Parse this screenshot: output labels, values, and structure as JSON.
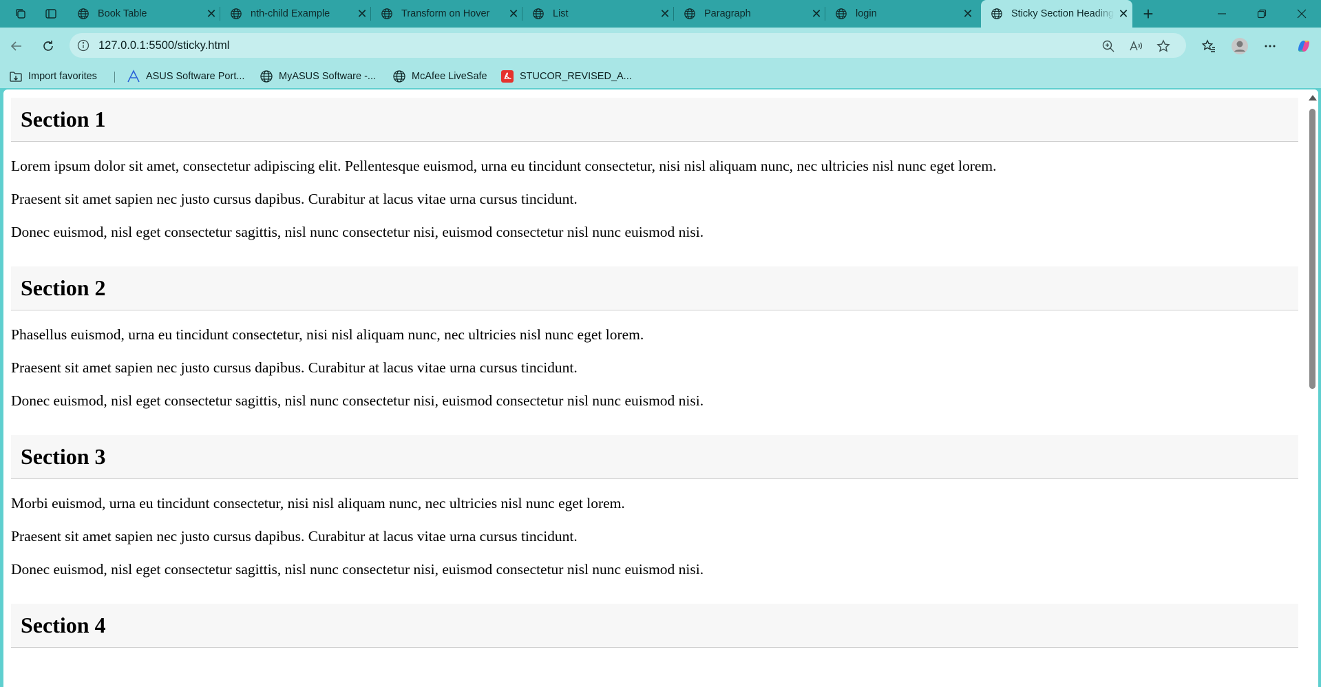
{
  "browser": {
    "tabs": [
      {
        "label": "Book Table",
        "active": false
      },
      {
        "label": "nth-child Example",
        "active": false
      },
      {
        "label": "Transform on Hover",
        "active": false
      },
      {
        "label": "List",
        "active": false
      },
      {
        "label": "Paragraph",
        "active": false
      },
      {
        "label": "login",
        "active": false
      },
      {
        "label": "Sticky Section Headings",
        "active": true
      }
    ],
    "new_tab_symbol": "+",
    "url": "127.0.0.1:5500/sticky.html",
    "favorites": [
      {
        "label": "Import favorites",
        "icon": "import-favorites-icon"
      },
      {
        "label": "ASUS Software Port...",
        "icon": "asus-logo-icon"
      },
      {
        "label": "MyASUS Software -...",
        "icon": "globe-icon"
      },
      {
        "label": "McAfee LiveSafe",
        "icon": "globe-icon"
      },
      {
        "label": "STUCOR_REVISED_A...",
        "icon": "pdf-icon"
      }
    ],
    "colors": {
      "tab_strip": "#2fa4a6",
      "toolbar": "#a9e6e6",
      "frame": "#5fcfcf"
    }
  },
  "page": {
    "sections": [
      {
        "heading": "Section 1",
        "paragraphs": [
          "Lorem ipsum dolor sit amet, consectetur adipiscing elit. Pellentesque euismod, urna eu tincidunt consectetur, nisi nisl aliquam nunc, nec ultricies nisl nunc eget lorem.",
          "Praesent sit amet sapien nec justo cursus dapibus. Curabitur at lacus vitae urna cursus tincidunt.",
          "Donec euismod, nisl eget consectetur sagittis, nisl nunc consectetur nisi, euismod consectetur nisl nunc euismod nisi."
        ]
      },
      {
        "heading": "Section 2",
        "paragraphs": [
          "Phasellus euismod, urna eu tincidunt consectetur, nisi nisl aliquam nunc, nec ultricies nisl nunc eget lorem.",
          "Praesent sit amet sapien nec justo cursus dapibus. Curabitur at lacus vitae urna cursus tincidunt.",
          "Donec euismod, nisl eget consectetur sagittis, nisl nunc consectetur nisi, euismod consectetur nisl nunc euismod nisi."
        ]
      },
      {
        "heading": "Section 3",
        "paragraphs": [
          "Morbi euismod, urna eu tincidunt consectetur, nisi nisl aliquam nunc, nec ultricies nisl nunc eget lorem.",
          "Praesent sit amet sapien nec justo cursus dapibus. Curabitur at lacus vitae urna cursus tincidunt.",
          "Donec euismod, nisl eget consectetur sagittis, nisl nunc consectetur nisi, euismod consectetur nisl nunc euismod nisi."
        ]
      },
      {
        "heading": "Section 4",
        "paragraphs": []
      }
    ]
  }
}
